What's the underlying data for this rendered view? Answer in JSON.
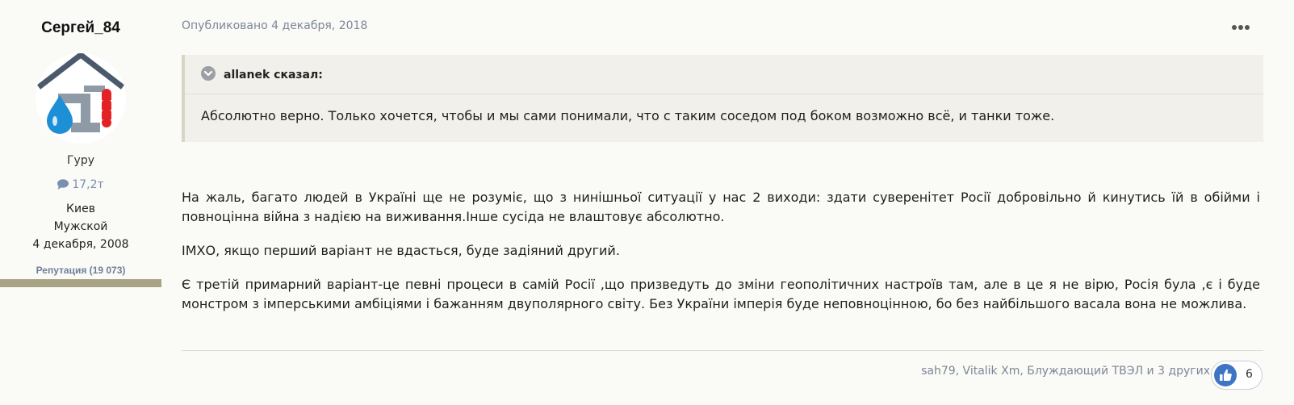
{
  "author": {
    "name": "Сергей_84",
    "rank": "Гуру",
    "posts_count": "17,2т",
    "city": "Киев",
    "gender": "Мужской",
    "joined": "4 декабря, 2008",
    "reputation": "Репутация (19 073)"
  },
  "post": {
    "published": "Опубликовано 4 декабря, 2018",
    "quote": {
      "author": "allanek сказал:",
      "text": "Абсолютно верно. Только хочется, чтобы и мы сами понимали, что с таким соседом под боком возможно всё, и танки тоже."
    },
    "paragraphs": [
      "На жаль, багато людей в Україні ще не розуміє, що з нинішньої ситуації у нас 2 виходи: здати суверенітет Росії добровільно й кинутись їй в обійми і повноцінна війна з надією на виживання.Інше сусіда не влаштовує абсолютно.",
      "ІМХО, якщо перший варіант не вдасться, буде задіяний другий.",
      "Є третій примарний варіант-це певні процеси в самій Росії ,що призведуть до зміни геополітичних настроїв там, але в це я не вірю, Росія була ,є і буде монстром з імперськими амбіціями і бажанням двуполярного світу. Без України імперія буде неповноцінною, бо без найбільшого васала вона не можлива."
    ],
    "reactions": {
      "users": [
        "sah79",
        "Vitalik Xm",
        "Блуждающий ТВЭЛ"
      ],
      "separator": ", ",
      "others": " и 3 других",
      "count": "6"
    }
  },
  "icons": {
    "menu": "ellipsis-icon",
    "quote_toggle": "chevron-down-circle-icon",
    "posts": "comment-icon",
    "like": "thumbs-up-icon"
  },
  "colors": {
    "background": "#fafaf7",
    "link": "#7a8fae",
    "like": "#3e74c4",
    "reputation_bar": "#a9a385"
  }
}
